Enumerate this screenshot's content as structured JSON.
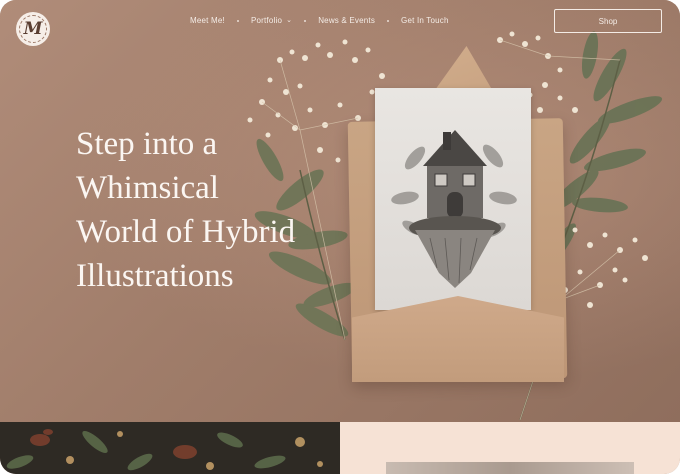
{
  "header": {
    "logo_letter": "M",
    "nav": [
      {
        "label": "Meet Me!"
      },
      {
        "label": "Portfolio",
        "has_dropdown": true
      },
      {
        "label": "News & Events"
      },
      {
        "label": "Get In Touch"
      }
    ],
    "shop_label": "Shop"
  },
  "hero": {
    "title_lines": [
      "Step into a",
      "Whimsical",
      "World of Hybrid",
      "Illustrations"
    ]
  },
  "colors": {
    "hero_background": "#a98470",
    "text_light": "#fbf6f2",
    "strip_dark": "#2e2a24",
    "strip_light": "#f6e2d5"
  },
  "icons": {
    "logo": "monogram-m-badge",
    "dropdown": "chevron-down-icon"
  }
}
